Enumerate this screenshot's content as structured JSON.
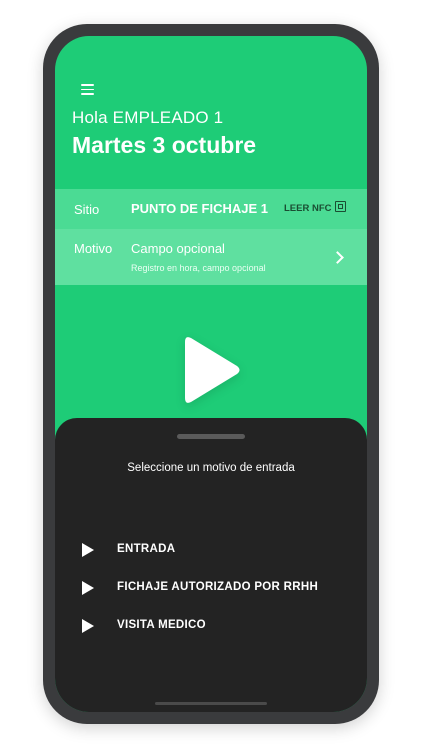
{
  "header": {
    "greeting": "Hola EMPLEADO 1",
    "date": "Martes 3 octubre",
    "menu_icon": "hamburger-menu-icon"
  },
  "info": {
    "site_label": "Sitio",
    "site_value": "PUNTO DE FICHAJE 1",
    "nfc_label": "LEER NFC",
    "nfc_icon": "nfc-icon",
    "motivo_label": "Motivo",
    "motivo_value": "Campo opcional",
    "motivo_hint": "Registro en hora, campo opcional",
    "chevron_icon": "chevron-right-icon"
  },
  "main": {
    "play_icon": "play-icon"
  },
  "sheet": {
    "title": "Seleccione un motivo de entrada",
    "options": [
      {
        "label": "ENTRADA"
      },
      {
        "label": "FICHAJE AUTORIZADO POR RRHH"
      },
      {
        "label": "VISITA MEDICO"
      }
    ]
  },
  "colors": {
    "brand_green": "#1ecc77",
    "panel_green": "#5fe0a0",
    "sheet_bg": "#232323",
    "frame": "#3a3b3d"
  }
}
